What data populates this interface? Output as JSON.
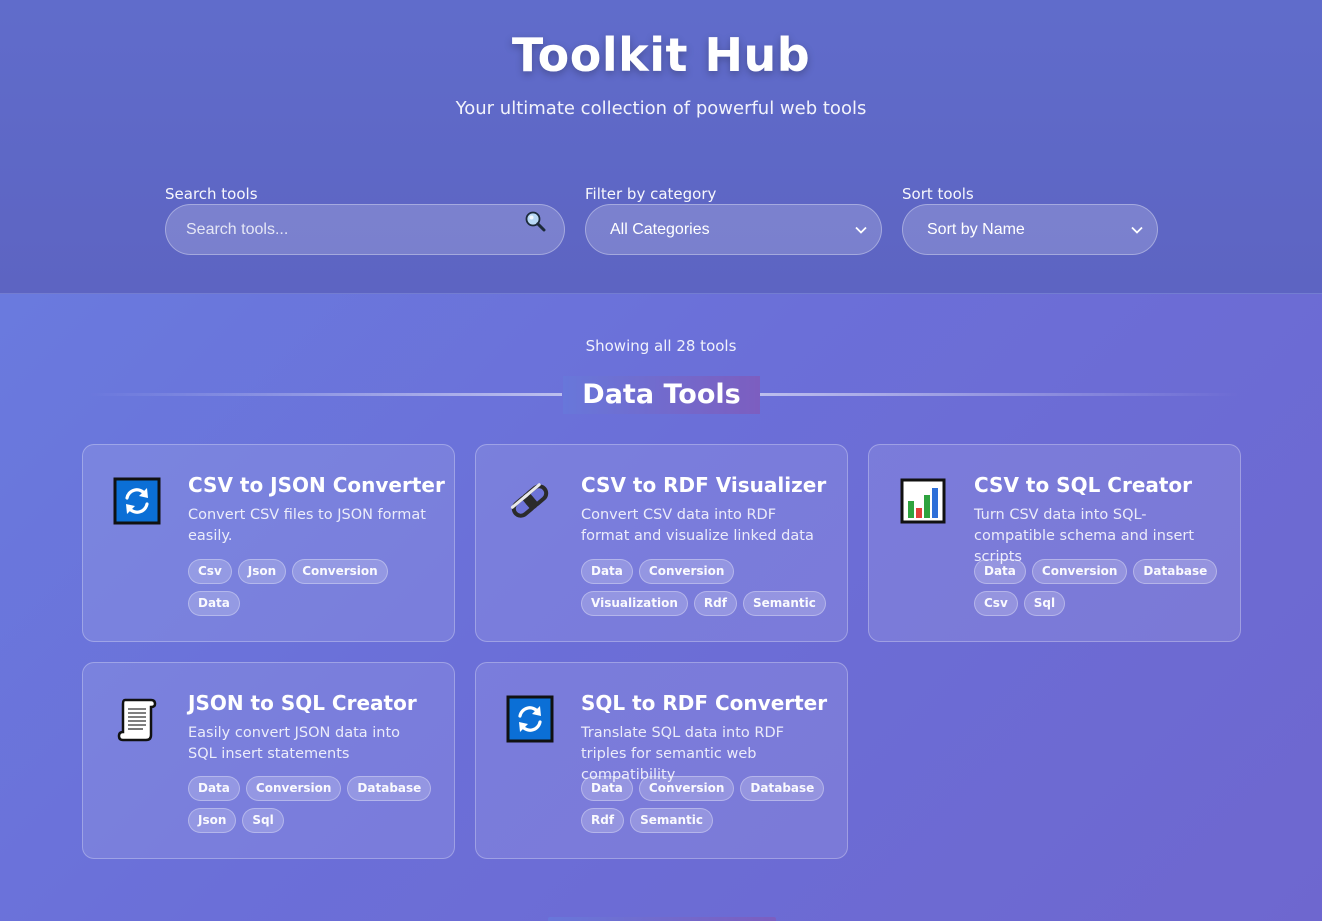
{
  "header": {
    "title": "Toolkit Hub",
    "subtitle": "Your ultimate collection of powerful web tools"
  },
  "controls": {
    "search_label": "Search tools",
    "search_placeholder": "Search tools...",
    "search_icon": "magnifier-icon",
    "filter_label": "Filter by category",
    "filter_value": "All Categories",
    "sort_label": "Sort tools",
    "sort_value": "Sort by Name"
  },
  "results": {
    "count_text": "Showing all 28 tools"
  },
  "section": {
    "title": "Data Tools"
  },
  "cards": [
    {
      "title": "CSV to JSON Converter",
      "description": "Convert CSV files to JSON format easily.",
      "icon": "refresh-arrows-icon",
      "tags": [
        "Csv",
        "Json",
        "Conversion",
        "Data"
      ]
    },
    {
      "title": "CSV to RDF Visualizer",
      "description": "Convert CSV data into RDF format and visualize linked data",
      "icon": "chain-link-icon",
      "tags": [
        "Data",
        "Conversion",
        "Visualization",
        "Rdf",
        "Semantic"
      ]
    },
    {
      "title": "CSV to SQL Creator",
      "description": "Turn CSV data into SQL-compatible schema and insert scripts",
      "icon": "bar-chart-icon",
      "tags": [
        "Data",
        "Conversion",
        "Database",
        "Csv",
        "Sql"
      ]
    },
    {
      "title": "JSON to SQL Creator",
      "description": "Easily convert JSON data into SQL insert statements",
      "icon": "scroll-icon",
      "tags": [
        "Data",
        "Conversion",
        "Database",
        "Json",
        "Sql"
      ]
    },
    {
      "title": "SQL to RDF Converter",
      "description": "Translate SQL data into RDF triples for semantic web compatibility",
      "icon": "refresh-arrows-icon",
      "tags": [
        "Data",
        "Conversion",
        "Database",
        "Rdf",
        "Semantic"
      ]
    }
  ],
  "colors": {
    "accent_blue": "#0b6fd6",
    "background": "#6b72db"
  }
}
